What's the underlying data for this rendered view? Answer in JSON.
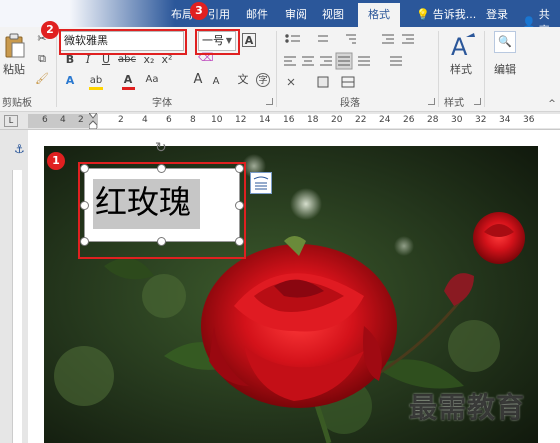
{
  "tabs": {
    "layout": "布局",
    "references": "引用",
    "mailings": "邮件",
    "review": "审阅",
    "view": "视图",
    "format": "格式",
    "tell_me": "告诉我...",
    "sign_in": "登录",
    "share": "共享"
  },
  "clipboard": {
    "paste_label": "粘贴",
    "group_label": "剪贴板"
  },
  "font": {
    "font_name": "微软雅黑",
    "font_size": "一号",
    "bold": "B",
    "italic": "I",
    "underline": "U",
    "strikethrough": "abc",
    "subscript": "x₂",
    "superscript": "x²",
    "grow": "A",
    "shrink": "A",
    "change_case": "Aa",
    "group_label": "字体",
    "pinyin": "文",
    "border_char": "A",
    "circle_char": "字",
    "text_effect": "A",
    "font_color": "A",
    "highlight": "ab"
  },
  "paragraph": {
    "group_label": "段落"
  },
  "styles": {
    "label": "样式",
    "group_label": "样式"
  },
  "editing": {
    "label": "编辑"
  },
  "ruler": {
    "numbers": [
      "6",
      "4",
      "2",
      "2",
      "4",
      "6",
      "8",
      "10",
      "12",
      "14",
      "16",
      "18",
      "20",
      "22",
      "24",
      "26",
      "28",
      "30",
      "32",
      "34",
      "36"
    ]
  },
  "document": {
    "textbox_text": "红玫瑰",
    "watermark": "最需教育"
  },
  "badges": [
    "1",
    "2",
    "3"
  ],
  "colors": {
    "accent": "#2b579a",
    "highlight_red": "#e02020",
    "font_color_bar": "#e02020",
    "highlight_bar": "#ffd400"
  }
}
